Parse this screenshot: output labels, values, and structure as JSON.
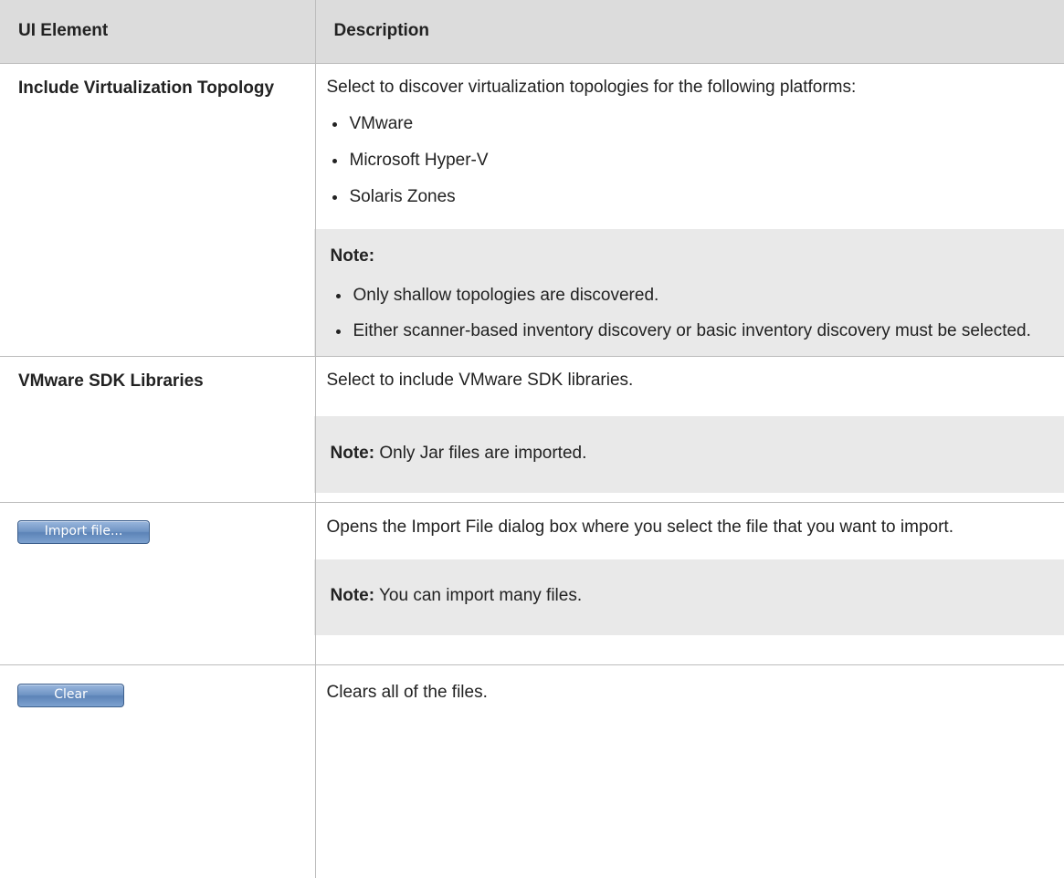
{
  "table": {
    "headers": [
      "UI Element",
      "Description"
    ],
    "rows": [
      {
        "element": "Include Virtualization Topology",
        "description": "Select to discover virtualization topologies for the following platforms:",
        "bullets": [
          "VMware",
          "Microsoft Hyper-V",
          "Solaris Zones"
        ],
        "note_label": "Note:",
        "note_bullets": [
          "Only shallow topologies are discovered.",
          "Either scanner-based inventory discovery or basic inventory discovery must be selected."
        ]
      },
      {
        "element": "VMware SDK Libraries",
        "description": "Select to include VMware SDK libraries.",
        "note_label": "Note:",
        "note_text": "Only Jar files are imported."
      },
      {
        "button_label": "Import file...",
        "description": "Opens the Import File dialog box where you select the file that you want to import.",
        "note_label": "Note:",
        "note_text": "You can import many files."
      },
      {
        "button_label": "Clear",
        "description": "Clears all of the files."
      }
    ]
  },
  "colors": {
    "header_bg": "#dcdcdc",
    "note_bg": "#e9e9e9",
    "border": "#bcbcbc",
    "button_blue": "#6f94c4",
    "text": "#222222"
  }
}
